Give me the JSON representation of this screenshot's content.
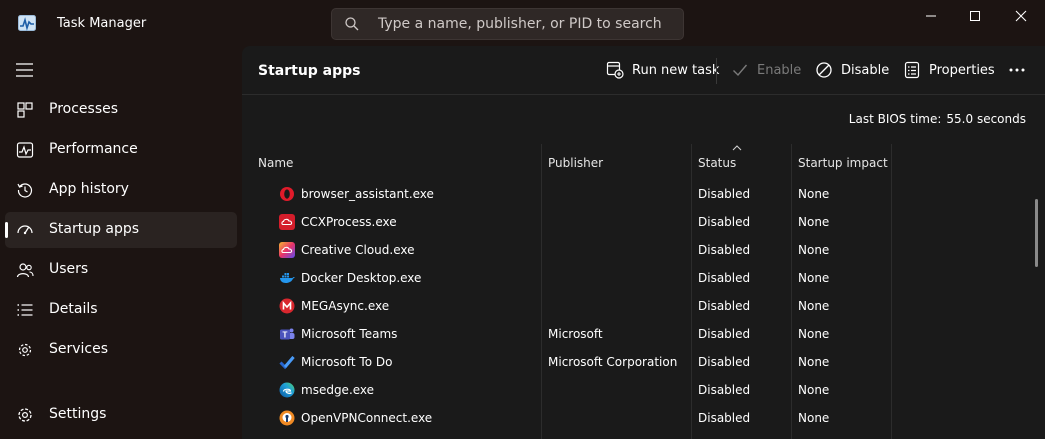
{
  "titlebar": {
    "title": "Task Manager",
    "search_placeholder": "Type a name, publisher, or PID to search"
  },
  "sidebar": {
    "items": [
      {
        "label": "Processes",
        "icon": "processes-icon"
      },
      {
        "label": "Performance",
        "icon": "performance-icon"
      },
      {
        "label": "App history",
        "icon": "app-history-icon"
      },
      {
        "label": "Startup apps",
        "icon": "startup-apps-icon",
        "active": true
      },
      {
        "label": "Users",
        "icon": "users-icon"
      },
      {
        "label": "Details",
        "icon": "details-icon"
      },
      {
        "label": "Services",
        "icon": "services-icon"
      }
    ],
    "settings_label": "Settings"
  },
  "main": {
    "title": "Startup apps",
    "toolbar": {
      "run_new_task": "Run new task",
      "enable": "Enable",
      "disable": "Disable",
      "properties": "Properties"
    },
    "bios_label": "Last BIOS time:",
    "bios_value": "55.0 seconds",
    "columns": {
      "name": "Name",
      "publisher": "Publisher",
      "status": "Status",
      "impact": "Startup impact"
    },
    "sorted_column": "Status",
    "rows": [
      {
        "name": "browser_assistant.exe",
        "publisher": "",
        "status": "Disabled",
        "impact": "None",
        "icon": "opera-icon"
      },
      {
        "name": "CCXProcess.exe",
        "publisher": "",
        "status": "Disabled",
        "impact": "None",
        "icon": "adobe-creative-cloud-icon"
      },
      {
        "name": "Creative Cloud.exe",
        "publisher": "",
        "status": "Disabled",
        "impact": "None",
        "icon": "creative-cloud-icon"
      },
      {
        "name": "Docker Desktop.exe",
        "publisher": "",
        "status": "Disabled",
        "impact": "None",
        "icon": "docker-icon"
      },
      {
        "name": "MEGAsync.exe",
        "publisher": "",
        "status": "Disabled",
        "impact": "None",
        "icon": "mega-icon"
      },
      {
        "name": "Microsoft Teams",
        "publisher": "Microsoft",
        "status": "Disabled",
        "impact": "None",
        "icon": "teams-icon"
      },
      {
        "name": "Microsoft To Do",
        "publisher": "Microsoft Corporation",
        "status": "Disabled",
        "impact": "None",
        "icon": "todo-icon"
      },
      {
        "name": "msedge.exe",
        "publisher": "",
        "status": "Disabled",
        "impact": "None",
        "icon": "edge-icon"
      },
      {
        "name": "OpenVPNConnect.exe",
        "publisher": "",
        "status": "Disabled",
        "impact": "None",
        "icon": "openvpn-icon"
      }
    ]
  },
  "colors": {
    "window_bg": "#1c1412",
    "content_bg": "#1a1a1a",
    "accent_text": "#ffffff",
    "disabled_text": "#7a7a7a"
  }
}
